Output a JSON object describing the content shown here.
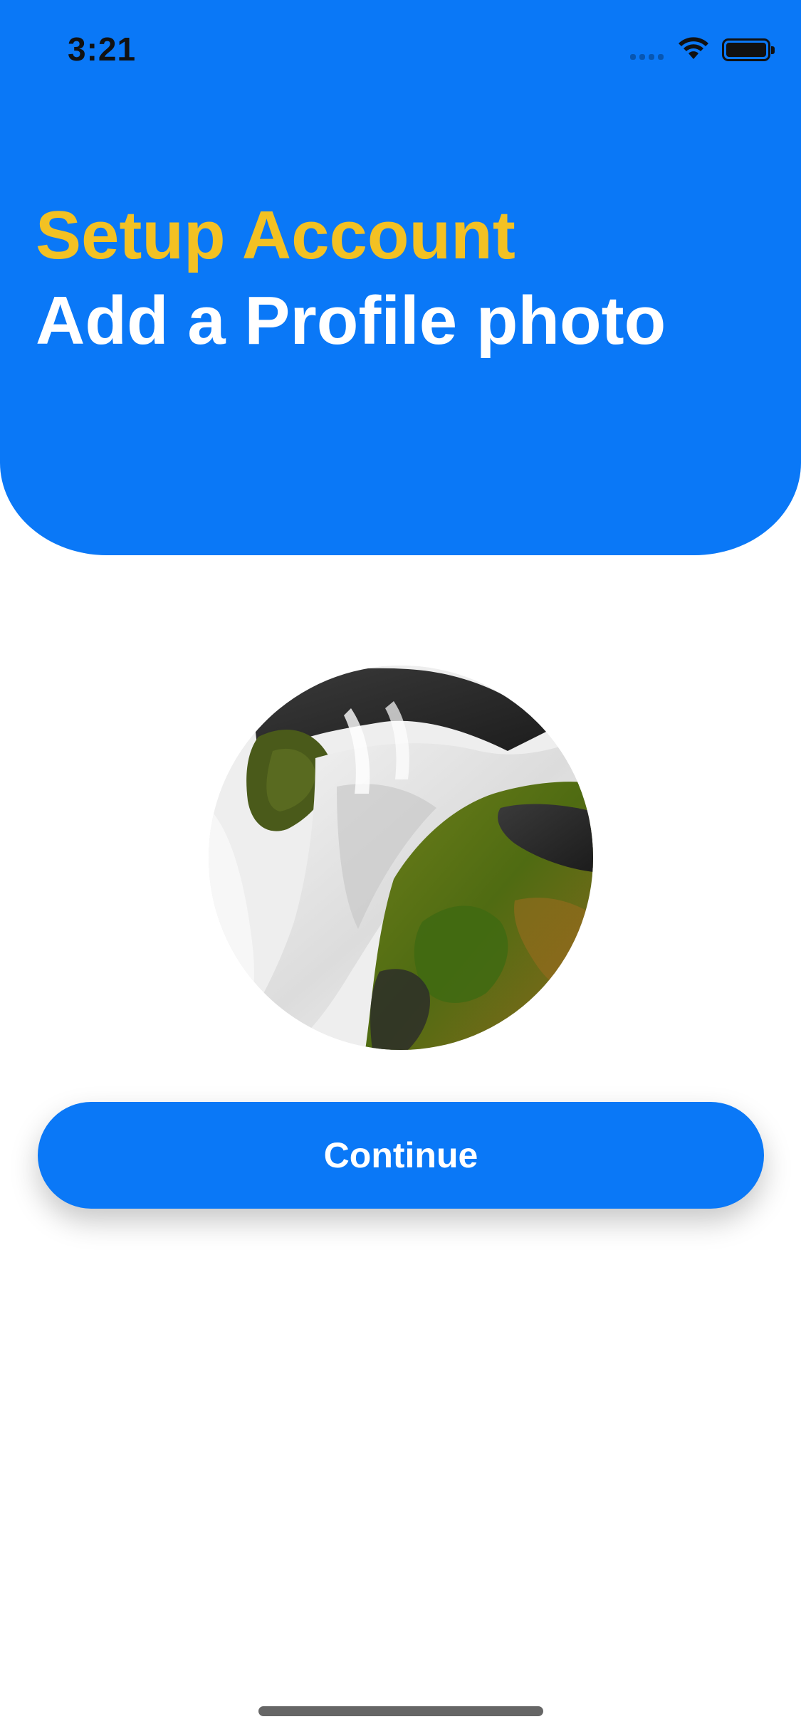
{
  "status_bar": {
    "time": "3:21",
    "signal_icon": "cellular-signal-icon",
    "wifi_icon": "wifi-icon",
    "battery_icon": "battery-icon"
  },
  "header": {
    "title": "Setup Account",
    "subtitle": "Add a Profile photo",
    "background_color": "#0a78f7",
    "title_color": "#f3c123"
  },
  "profile_photo": {
    "description_icon": "profile-photo"
  },
  "actions": {
    "continue_label": "Continue",
    "button_color": "#0a78f7"
  }
}
